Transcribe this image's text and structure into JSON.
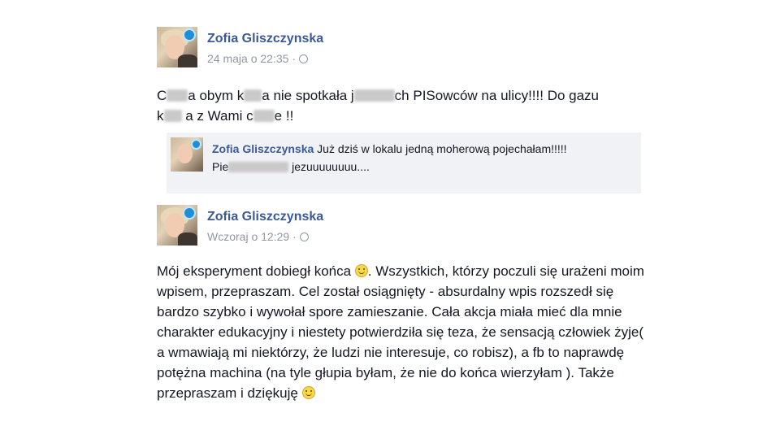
{
  "post1": {
    "author": "Zofia Gliszczynska",
    "time": "24 maja o 22:35",
    "separator": "·",
    "text": {
      "a": "C",
      "b": "a obym k",
      "c": "a nie spotkała j",
      "d": "ch PISowców na ulicy!!!! Do gazu",
      "e": "k",
      "f": "a z Wami c",
      "g": "e !!"
    },
    "shared_comment": {
      "author": "Zofia Gliszczynska",
      "text_line1": " Już dziś w lokalu jedną moherową pojechałam!!!!!",
      "text_line2_start": "Pie",
      "text_line2_end": " jezuuuuuuuu...."
    }
  },
  "post2": {
    "author": "Zofia Gliszczynska",
    "time": "Wczoraj o 12:29",
    "separator": "·",
    "text": {
      "p1": "Mój eksperyment dobiegł końca ",
      "p2": ". Wszystkich, którzy poczuli się urażeni moim wpisem, przepraszam. Cel został osiągnięty - absurdalny wpis rozszedł się bardzo szybko i wywołał spore zamieszanie. Cała akcja miała mieć dla mnie charakter edukacyjny i niestety potwierdziła się teza, że sensacją człowiek żyje( a wmawiają mi niektórzy, że ludzi nie interesuje, co robisz), a fb to naprawdę potężna machina (na tyle głupia byłam, że nie do końca wierzyłam ). Także przepraszam i dziękuję "
    }
  },
  "icons": {
    "globe": "globe-icon",
    "smiley": "smiley-emoji-icon"
  },
  "colors": {
    "name": "#3b5998",
    "meta": "#9197a3",
    "shared_bg": "#f1f2f6"
  }
}
